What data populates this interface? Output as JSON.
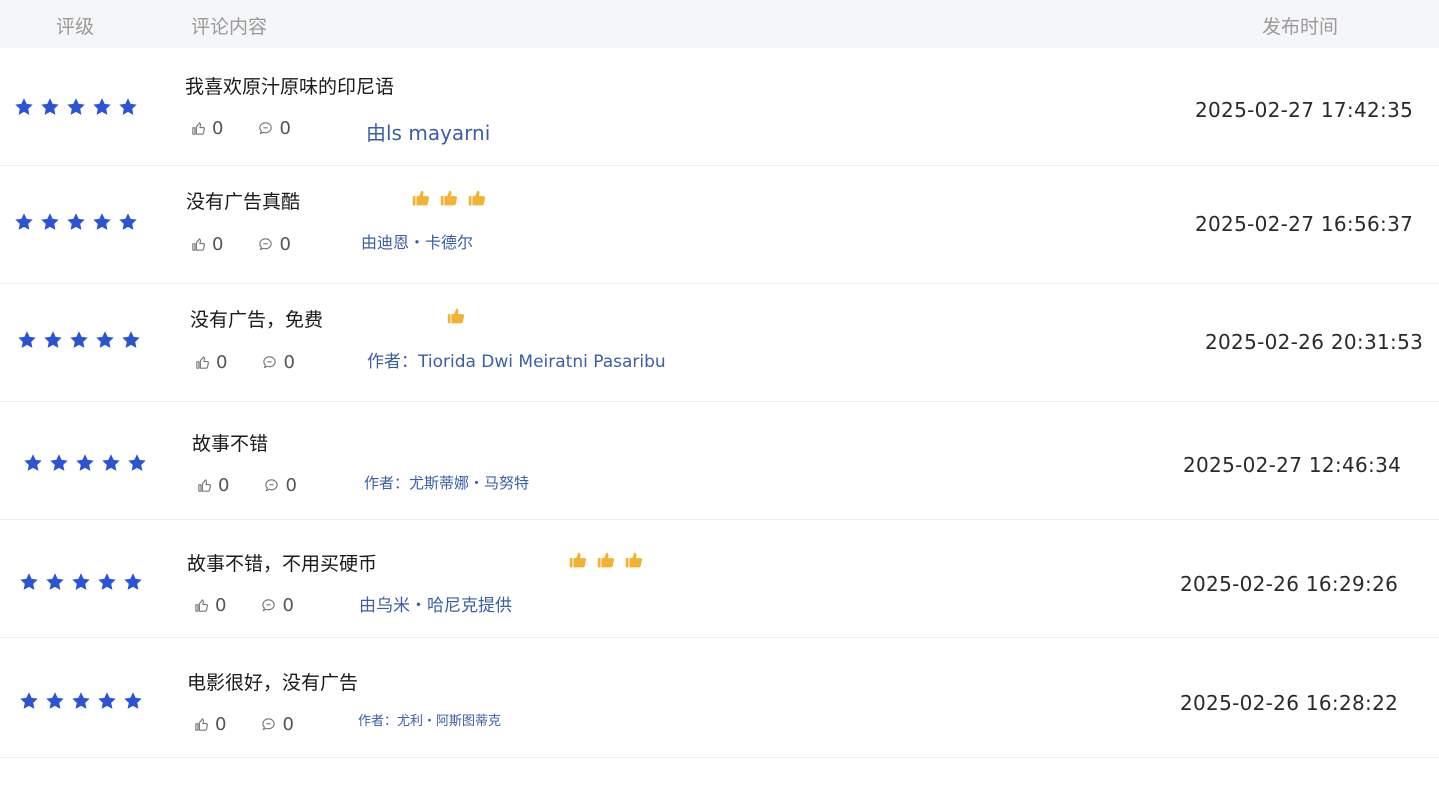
{
  "header": {
    "rating": "评级",
    "content": "评论内容",
    "time": "发布时间"
  },
  "colors": {
    "star": "#2b54d4",
    "author": "#3a5ea8",
    "thumb_emoji": "#f2b233"
  },
  "reviews": [
    {
      "rating": 5,
      "text": "我喜欢原汁原味的印尼语",
      "thumb_emojis": 0,
      "likes": "0",
      "comments": "0",
      "author": "由ls mayarni",
      "time": "2025-02-27 17:42:35"
    },
    {
      "rating": 5,
      "text": "没有广告真酷",
      "thumb_emojis": 3,
      "likes": "0",
      "comments": "0",
      "author": "由迪恩・卡德尔",
      "time": "2025-02-27 16:56:37"
    },
    {
      "rating": 5,
      "text": "没有广告，免费",
      "thumb_emojis": 1,
      "likes": "0",
      "comments": "0",
      "author": "作者：Tiorida Dwi Meiratni Pasaribu",
      "time": "2025-02-26 20:31:53"
    },
    {
      "rating": 5,
      "text": "故事不错",
      "thumb_emojis": 0,
      "likes": "0",
      "comments": "0",
      "author": "作者：尤斯蒂娜・马努特",
      "time": "2025-02-27 12:46:34"
    },
    {
      "rating": 5,
      "text": "故事不错，不用买硬币",
      "thumb_emojis": 3,
      "likes": "0",
      "comments": "0",
      "author": "由乌米・哈尼克提供",
      "time": "2025-02-26 16:29:26"
    },
    {
      "rating": 5,
      "text": "电影很好，没有广告",
      "thumb_emojis": 0,
      "likes": "0",
      "comments": "0",
      "author": "作者：尤利・阿斯图蒂克",
      "time": "2025-02-26 16:28:22"
    }
  ]
}
